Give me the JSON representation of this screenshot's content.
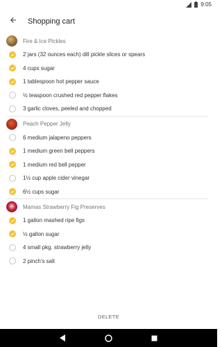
{
  "status_bar": {
    "time": "9:05"
  },
  "app_bar": {
    "title": "Shopping cart"
  },
  "colors": {
    "accent": "#f2c232",
    "unchecked_border": "#c4c4c4",
    "nav_bar": "#000000"
  },
  "recipes": [
    {
      "name": "Fire & Ice Pickles",
      "items": [
        {
          "text": "2 jars (32 ounces each) dill pickle slices or spears",
          "checked": true
        },
        {
          "text": "4 cups sugar",
          "checked": true
        },
        {
          "text": "1 tablespoon hot pepper sauce",
          "checked": true
        },
        {
          "text": "½ teaspoon crushed red pepper flakes",
          "checked": false
        },
        {
          "text": "3 garlic cloves, peeled and chopped",
          "checked": false
        }
      ]
    },
    {
      "name": "Peach Pepper Jelly",
      "items": [
        {
          "text": "6 medium jalapeno peppers",
          "checked": false
        },
        {
          "text": "1 medium green bell peppers",
          "checked": true
        },
        {
          "text": "1 medium red bell pepper",
          "checked": true
        },
        {
          "text": "1½ cup apple cider vinegar",
          "checked": false
        },
        {
          "text": "6½ cups sugar",
          "checked": true
        }
      ]
    },
    {
      "name": "Mamas Strawberry Fig Preserves",
      "items": [
        {
          "text": "1 gallon mashed ripe figs",
          "checked": true
        },
        {
          "text": "½ gallon sugar",
          "checked": true
        },
        {
          "text": "4 small pkg. strawberry jelly",
          "checked": false
        },
        {
          "text": "2 pinch's salt",
          "checked": false
        }
      ]
    }
  ],
  "footer": {
    "delete_label": "DELETE"
  }
}
